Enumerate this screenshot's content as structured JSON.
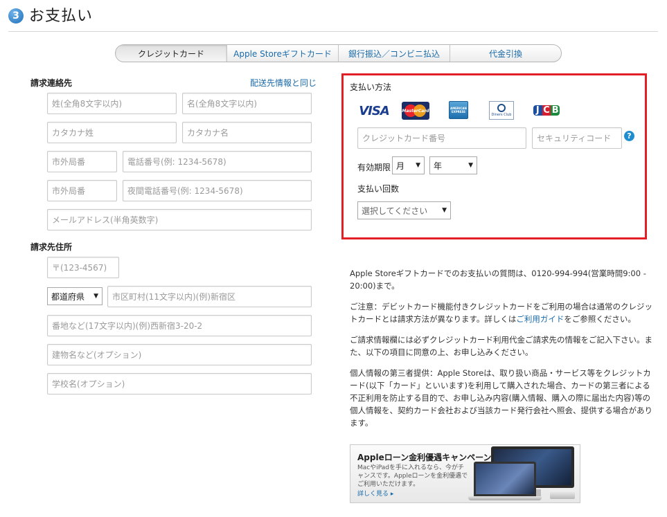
{
  "step": {
    "number": "3",
    "title": "お支払い"
  },
  "tabs": [
    {
      "label": "クレジットカード"
    },
    {
      "label": "Apple Storeギフトカード"
    },
    {
      "label": "銀行振込／コンビニ払込"
    },
    {
      "label": "代金引換"
    }
  ],
  "billing_contact": {
    "title": "請求連絡先",
    "same_as_shipping_link": "配送先情報と同じ",
    "last_name_placeholder": "姓(全角8文字以内)",
    "first_name_placeholder": "名(全角8文字以内)",
    "kana_last_placeholder": "カタカナ姓",
    "kana_first_placeholder": "カタカナ名",
    "area_code_placeholder": "市外局番",
    "phone_placeholder": "電話番号(例: 1234-5678)",
    "night_area_code_placeholder": "市外局番",
    "night_phone_placeholder": "夜間電話番号(例: 1234-5678)",
    "email_placeholder": "メールアドレス(半角英数字)"
  },
  "billing_address": {
    "title": "請求先住所",
    "postal_placeholder": "〒(123-4567)",
    "prefecture_selected": "都道府県",
    "city_placeholder": "市区町村(11文字以内)(例)新宿区",
    "street_placeholder": "番地など(17文字以内)(例)西新宿3-20-2",
    "building_placeholder": "建物名など(オプション)",
    "school_placeholder": "学校名(オプション)"
  },
  "payment": {
    "method_label": "支払い方法",
    "cards": {
      "visa": "VISA",
      "mastercard": "MasterCard",
      "amex": "AMERICAN EXPRESS",
      "diners": "Diners Club",
      "jcb": [
        "J",
        "C",
        "B"
      ]
    },
    "card_number_placeholder": "クレジットカード番号",
    "security_code_placeholder": "セキュリティコード",
    "help_symbol": "?",
    "expiry_label": "有効期限",
    "month_selected": "月",
    "year_selected": "年",
    "installments_label": "支払い回数",
    "installments_selected": "選択してください",
    "highlight_color": "#e21f26"
  },
  "info": {
    "gift_card_note": "Apple Storeギフトカードでのお支払いの質問は、0120-994-994(営業時間9:00 - 20:00)まで。",
    "debit_note_before": "ご注意：デビットカード機能付きクレジットカードをご利用の場合は通常のクレジットカードとは請求方法が異なります。詳しくは",
    "debit_note_link": "ご利用ガイド",
    "debit_note_after": "をご参照ください。",
    "billing_info_note": "ご請求情報欄には必ずクレジットカード利用代金ご請求先の情報をご記入下さい。また、以下の項目に同意の上、お申し込みください。",
    "privacy_note": "個人情報の第三者提供：Apple Storeは、取り扱い商品・サービス等をクレジットカード(以下「カード」といいます)を利用して購入された場合、カードの第三者による不正利用を防止する目的で、お申し込み内容(購入情報、購入の際に届出た内容)等の個人情報を、契約カード会社および当該カード発行会社へ照会、提供する場合があります。"
  },
  "banner": {
    "title": "Appleローン金利優遇キャンペーン",
    "body": "MacやiPadを手に入れるなら、今がチャンスです。Appleローンを金利優遇でご利用いただけます。",
    "link": "詳しく見る ▸"
  },
  "icons": {
    "select_arrow": "▼"
  }
}
